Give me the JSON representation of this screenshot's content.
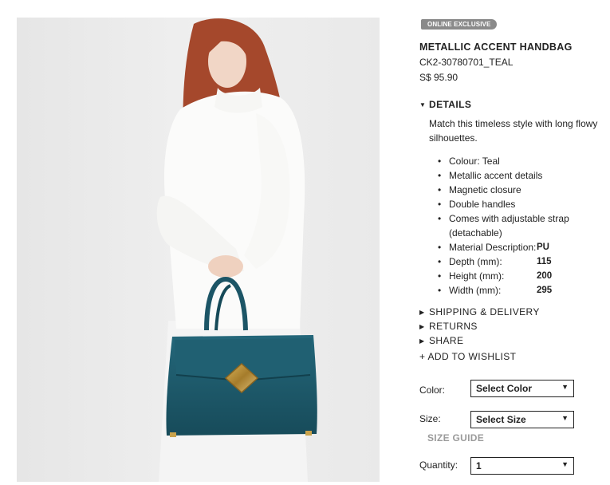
{
  "product": {
    "badge": "ONLINE EXCLUSIVE",
    "title": "METALLIC ACCENT HANDBAG",
    "sku": "CK2-30780701_TEAL",
    "price": "S$ 95.90"
  },
  "details": {
    "heading": "DETAILS",
    "description": "Match this timeless style with long flowy silhouettes.",
    "features": [
      "Colour: Teal",
      "Metallic accent details",
      "Magnetic closure",
      "Double handles",
      "Comes with adjustable strap (detachable)"
    ],
    "specs": [
      {
        "label": "Material Description:",
        "value": "PU"
      },
      {
        "label": "Depth (mm):",
        "value": "115"
      },
      {
        "label": "Height (mm):",
        "value": "200"
      },
      {
        "label": "Width (mm):",
        "value": "295"
      }
    ]
  },
  "sections": {
    "shipping": "SHIPPING & DELIVERY",
    "returns": "RETURNS",
    "share": "SHARE",
    "wishlist": "+ ADD TO WISHLIST"
  },
  "options": {
    "color_label": "Color:",
    "color_value": "Select Color",
    "size_label": "Size:",
    "size_value": "Select Size",
    "size_guide": "SIZE GUIDE",
    "quantity_label": "Quantity:",
    "quantity_value": "1"
  },
  "colors": {
    "bag_teal": "#1e5a6b",
    "badge_gray": "#8a8a8a",
    "hair": "#a5482c"
  },
  "icons": {
    "expanded": "caret-down-icon",
    "collapsed": "caret-right-icon",
    "dropdown": "dropdown-arrow-icon"
  }
}
